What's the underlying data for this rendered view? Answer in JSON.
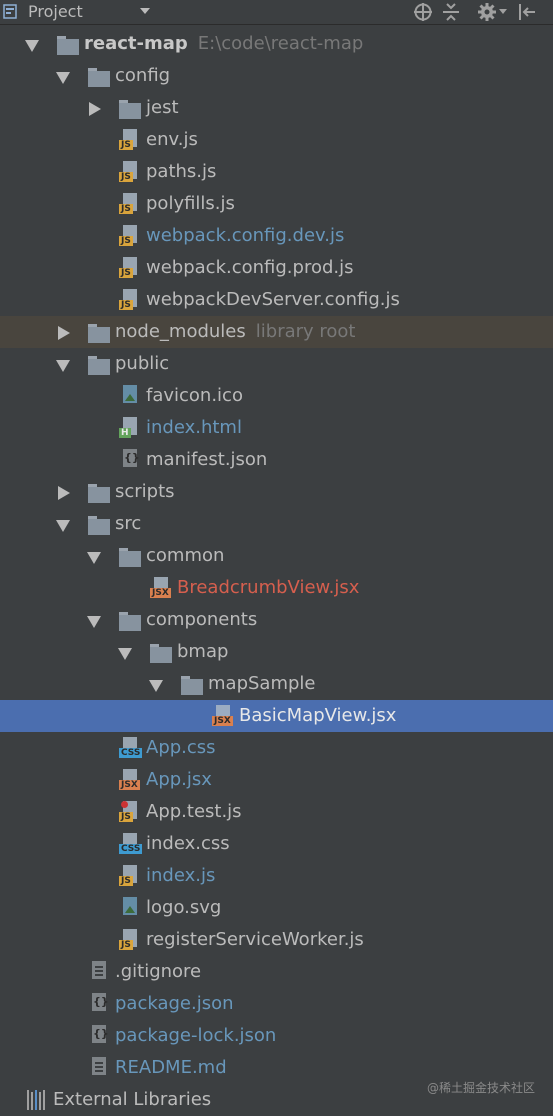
{
  "toolbar": {
    "title": "Project",
    "icons": [
      "project-icon",
      "locate-icon",
      "collapse-icon",
      "gear-icon",
      "hide-icon"
    ]
  },
  "colors": {
    "background": "#3c3f41",
    "selection": "#4b6eaf",
    "excluded_row": "#49453e",
    "modified_file": "#6897bb",
    "error_file": "#d65f4e",
    "folder": "#87939f"
  },
  "tree": [
    {
      "label": "react-map",
      "hint": "E:\\code\\react-map",
      "kind": "folder",
      "expanded": true,
      "bold": true
    },
    {
      "label": "config",
      "kind": "folder",
      "expanded": true
    },
    {
      "label": "jest",
      "kind": "folder",
      "expanded": false
    },
    {
      "label": "env.js",
      "kind": "js"
    },
    {
      "label": "paths.js",
      "kind": "js"
    },
    {
      "label": "polyfills.js",
      "kind": "js"
    },
    {
      "label": "webpack.config.dev.js",
      "kind": "js",
      "status": "modified"
    },
    {
      "label": "webpack.config.prod.js",
      "kind": "js"
    },
    {
      "label": "webpackDevServer.config.js",
      "kind": "js"
    },
    {
      "label": "node_modules",
      "hint": "library root",
      "kind": "folder",
      "expanded": false,
      "excluded": true
    },
    {
      "label": "public",
      "kind": "folder",
      "expanded": true
    },
    {
      "label": "favicon.ico",
      "kind": "image"
    },
    {
      "label": "index.html",
      "kind": "html",
      "status": "modified"
    },
    {
      "label": "manifest.json",
      "kind": "json"
    },
    {
      "label": "scripts",
      "kind": "folder",
      "expanded": false
    },
    {
      "label": "src",
      "kind": "folder",
      "expanded": true
    },
    {
      "label": "common",
      "kind": "folder",
      "expanded": true
    },
    {
      "label": "BreadcrumbView.jsx",
      "kind": "jsx",
      "status": "error"
    },
    {
      "label": "components",
      "kind": "folder",
      "expanded": true
    },
    {
      "label": "bmap",
      "kind": "folder",
      "expanded": true
    },
    {
      "label": "mapSample",
      "kind": "folder",
      "expanded": true
    },
    {
      "label": "BasicMapView.jsx",
      "kind": "jsx",
      "selected": true
    },
    {
      "label": "App.css",
      "kind": "css",
      "status": "modified"
    },
    {
      "label": "App.jsx",
      "kind": "jsx",
      "status": "modified"
    },
    {
      "label": "App.test.js",
      "kind": "test"
    },
    {
      "label": "index.css",
      "kind": "css"
    },
    {
      "label": "index.js",
      "kind": "js",
      "status": "modified"
    },
    {
      "label": "logo.svg",
      "kind": "image"
    },
    {
      "label": "registerServiceWorker.js",
      "kind": "js"
    },
    {
      "label": ".gitignore",
      "kind": "text"
    },
    {
      "label": "package.json",
      "kind": "json",
      "status": "modified"
    },
    {
      "label": "package-lock.json",
      "kind": "json",
      "status": "modified"
    },
    {
      "label": "README.md",
      "kind": "text",
      "status": "modified"
    },
    {
      "label": "External Libraries",
      "kind": "libraries"
    }
  ],
  "watermark": "@稀土掘金技术社区"
}
